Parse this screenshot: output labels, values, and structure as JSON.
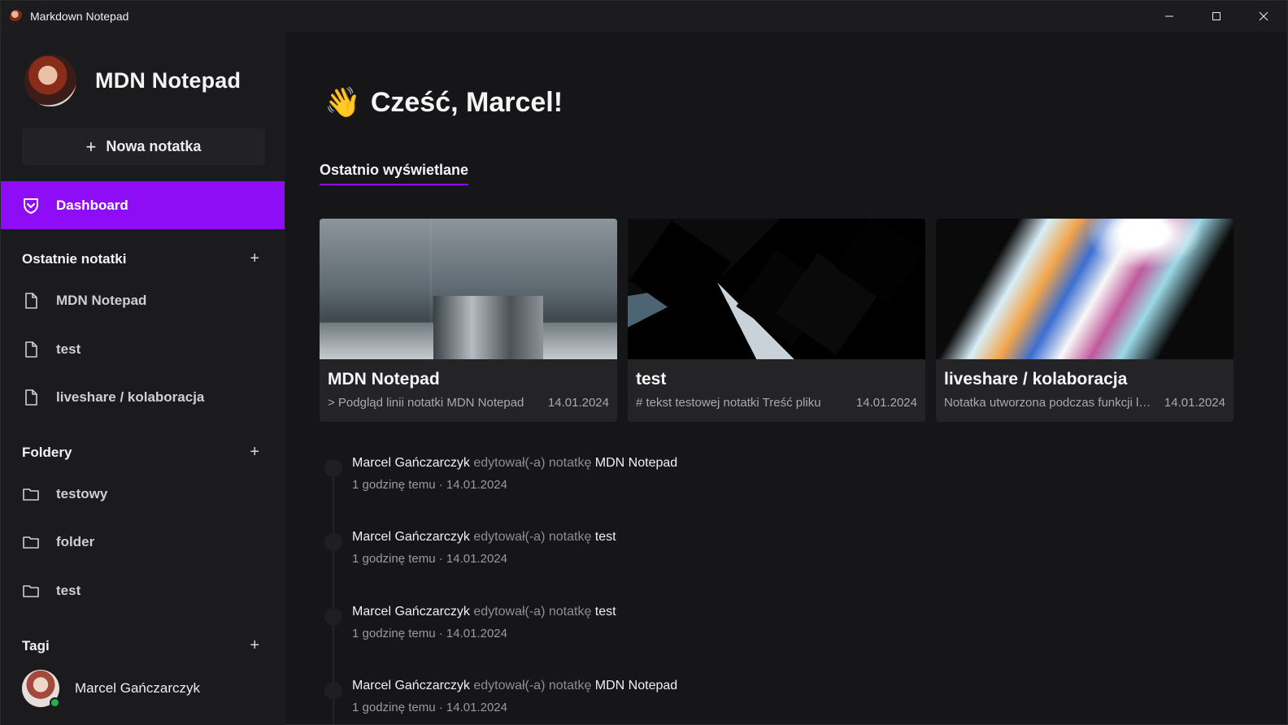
{
  "window": {
    "title": "Markdown Notepad",
    "controls": [
      "minimize",
      "maximize",
      "close"
    ]
  },
  "sidebar": {
    "brand": "MDN Notepad",
    "new_note_label": "Nowa notatka",
    "active_nav": "Dashboard",
    "sections": {
      "recent_notes": {
        "title": "Ostatnie notatki",
        "items": [
          "MDN Notepad",
          "test",
          "liveshare / kolaboracja"
        ]
      },
      "folders": {
        "title": "Foldery",
        "items": [
          "testowy",
          "folder",
          "test"
        ]
      },
      "tags": {
        "title": "Tagi"
      }
    },
    "user": {
      "name": "Marcel Gańczarczyk",
      "status": "online"
    }
  },
  "main": {
    "wave_icon": "👋",
    "greeting": "Cześć, Marcel!",
    "tab": "Ostatnio wyświetlane",
    "cards": [
      {
        "title": "MDN Notepad",
        "preview": "> Podgląd linii notatki MDN Notepad",
        "date": "14.01.2024"
      },
      {
        "title": "test",
        "preview": "# tekst testowej notatki  Treść pliku",
        "date": "14.01.2024"
      },
      {
        "title": "liveshare / kolaboracja",
        "preview": "Notatka utworzona podczas funkcji liveshare",
        "date": "14.01.2024"
      }
    ],
    "activity": [
      {
        "user": "Marcel Gańczarczyk",
        "action": "edytował(-a) notatkę",
        "note": "MDN Notepad",
        "time": "1 godzinę temu",
        "date": "14.01.2024"
      },
      {
        "user": "Marcel Gańczarczyk",
        "action": "edytował(-a) notatkę",
        "note": "test",
        "time": "1 godzinę temu",
        "date": "14.01.2024"
      },
      {
        "user": "Marcel Gańczarczyk",
        "action": "edytował(-a) notatkę",
        "note": "test",
        "time": "1 godzinę temu",
        "date": "14.01.2024"
      },
      {
        "user": "Marcel Gańczarczyk",
        "action": "edytował(-a) notatkę",
        "note": "MDN Notepad",
        "time": "1 godzinę temu",
        "date": "14.01.2024"
      }
    ],
    "separator": "·"
  },
  "colors": {
    "accent": "#8f0cf7",
    "background": "#161618",
    "sidebar": "#1b1b1d",
    "online": "#1fb34a"
  }
}
